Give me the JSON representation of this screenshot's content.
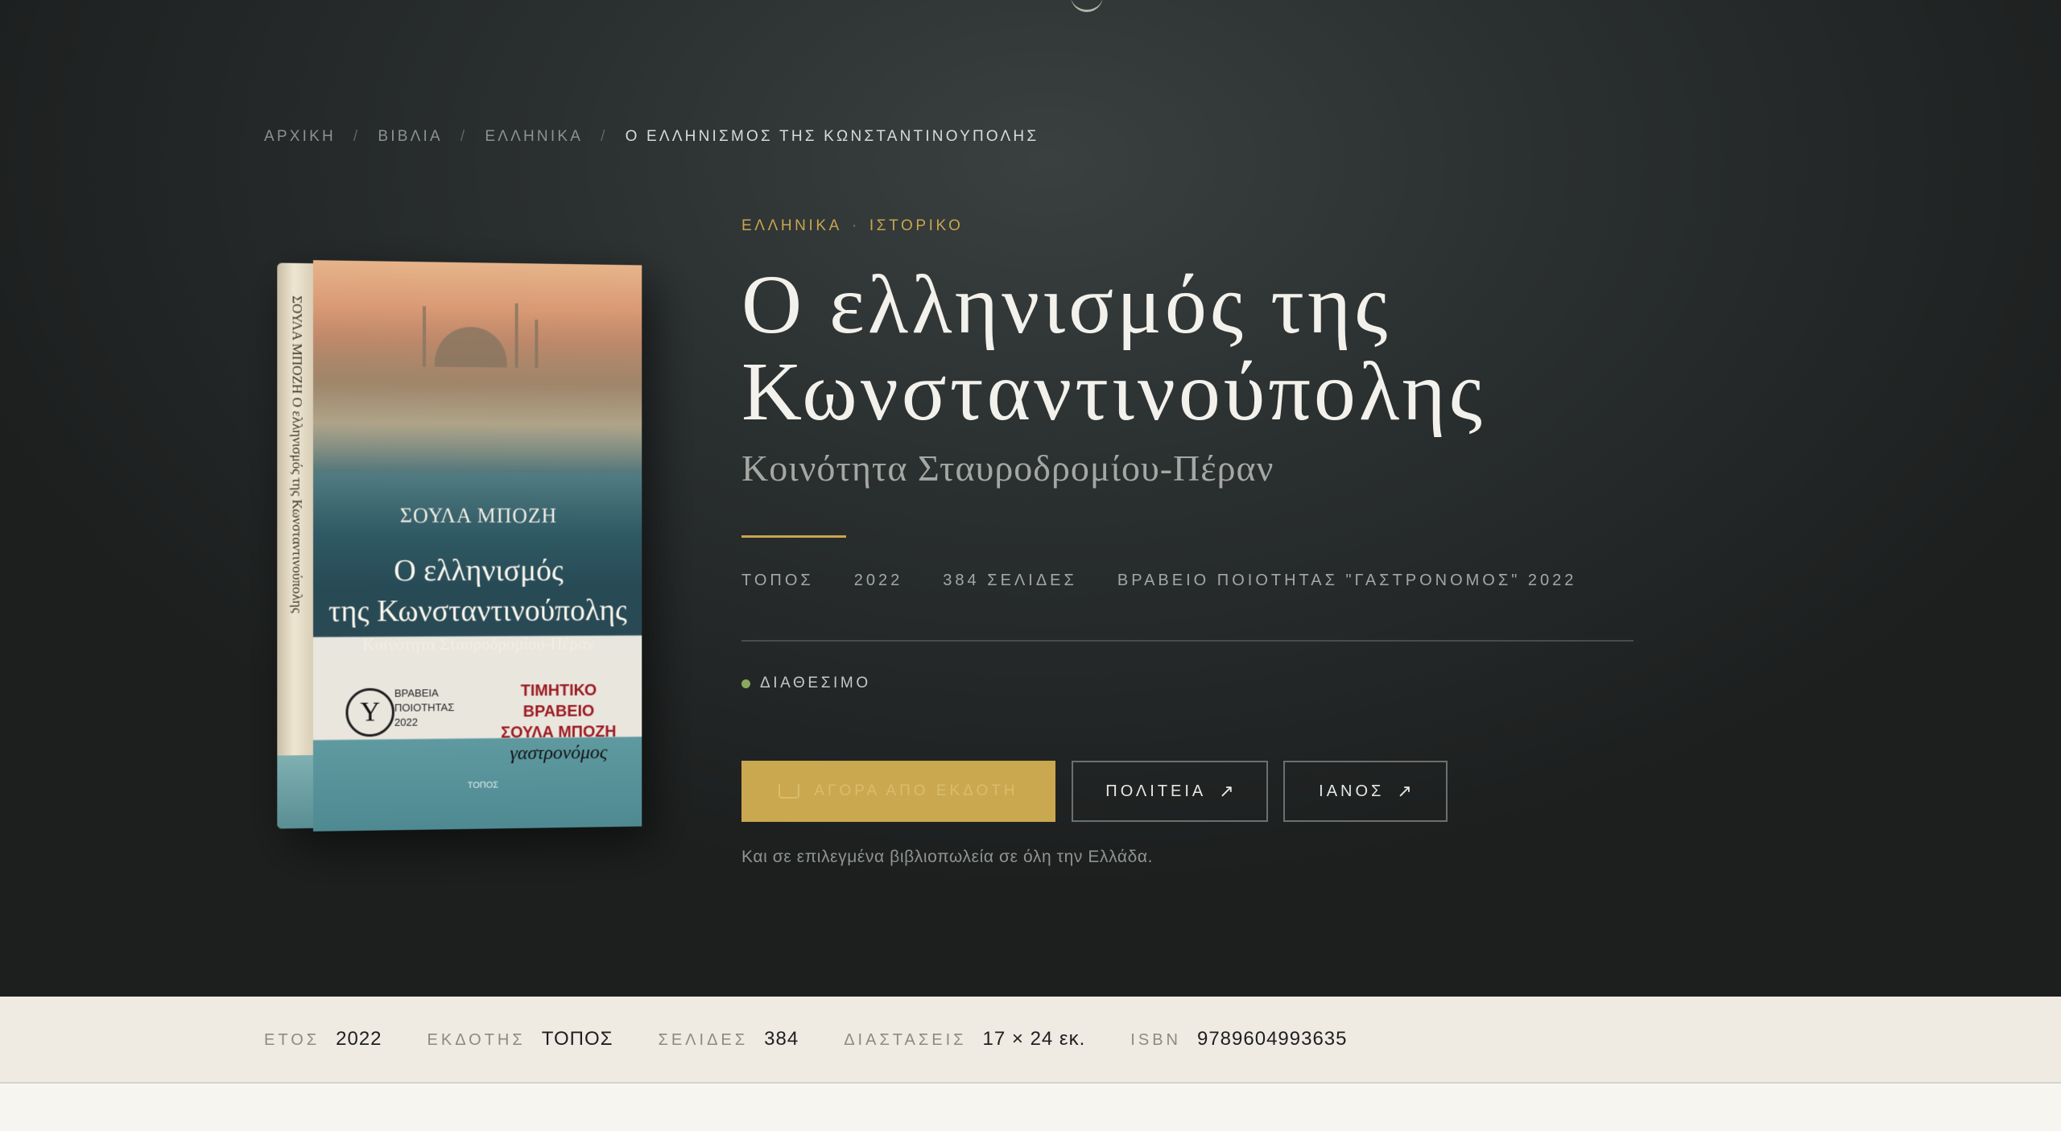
{
  "breadcrumb": {
    "items": [
      "ΑΡΧΙΚΗ",
      "ΒΙΒΛΙΑ",
      "ΕΛΛΗΝΙΚΑ"
    ],
    "separator": "/",
    "current": "Ο ΕΛΛΗΝΙΣΜΟΣ ΤΗΣ ΚΩΝΣΤΑΝΤΙΝΟΥΠΟΛΗΣ"
  },
  "book_cover": {
    "spine_text": "ΣΟΥΛΑ ΜΠΟΖΗ   Ο ελληνισμός της Κωνσταντινούπολης",
    "author": "ΣΟΥΛΑ ΜΠΟΖΗ",
    "title_line1": "Ο ελληνισμός",
    "title_line2": "της Κωνσταντινούπολης",
    "subtitle": "Κοινότητα Σταυροδρομίου-Πέραν",
    "award_seal": "Υ",
    "award_left": "ΒΡΑΒΕΙΑ ΠΟΙΟΤΗΤΑΣ 2022",
    "award_right1": "ΤΙΜΗΤΙΚΟ ΒΡΑΒΕΙΟ",
    "award_right2": "ΣΟΥΛΑ ΜΠΟΖΗ",
    "award_right3": "γαστρονόμος",
    "publisher_logo": "ΤΟΠΟΣ"
  },
  "genres": [
    "ΕΛΛΗΝΙΚΑ",
    "ΙΣΤΟΡΙΚΟ"
  ],
  "genre_separator": "·",
  "title": "Ο ελληνισμός της Κωνσταντινούπολης",
  "subtitle": "Κοινότητα Σταυροδρομίου-Πέραν",
  "meta": [
    "ΤΟΠΟΣ",
    "2022",
    "384 ΣΕΛΙΔΕΣ",
    "ΒΡΑΒΕΙΟ ΠΟΙΟΤΗΤΑΣ \"ΓΑΣΤΡΟΝΟΜΟΣ\" 2022"
  ],
  "status": {
    "label": "ΔΙΑΘΕΣΙΜΟ",
    "color": "#8aa85b"
  },
  "actions": {
    "buy_label": "ΑΓΟΡΑ ΑΠΟ ΕΚΔΟΤΗ",
    "politeia_label": "ΠΟΛΙΤΕΙΑ",
    "ianos_label": "ΙΑΝΟΣ",
    "external_arrow": "↗"
  },
  "note": "Και σε επιλεγμένα βιβλιοπωλεία σε όλη την Ελλάδα.",
  "specs": [
    {
      "key": "ΕΤΟΣ",
      "value": "2022"
    },
    {
      "key": "ΕΚΔΟΤΗΣ",
      "value": "ΤΟΠΟΣ"
    },
    {
      "key": "ΣΕΛΙΔΕΣ",
      "value": "384"
    },
    {
      "key": "ΔΙΑΣΤΑΣΕΙΣ",
      "value": "17 × 24 εκ."
    },
    {
      "key": "ISBN",
      "value": "9789604993635"
    }
  ],
  "colors": {
    "accent_gold": "#c9a64e",
    "hero_bg": "#2a2f2f",
    "specs_bg": "#efebe3"
  }
}
